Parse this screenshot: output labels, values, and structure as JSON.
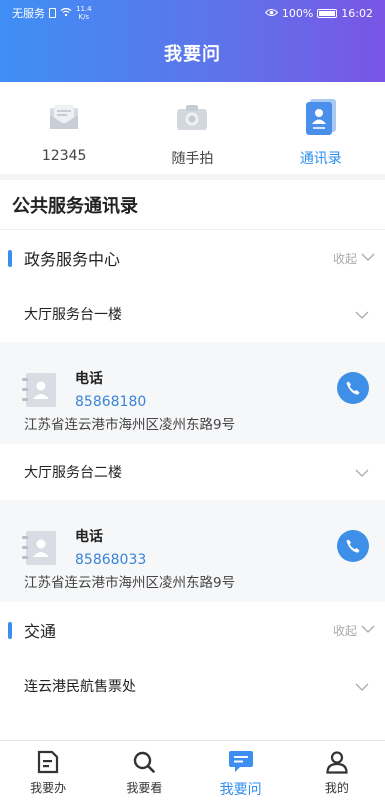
{
  "status": {
    "carrier": "无服务",
    "net_speed": "11.4",
    "net_unit": "K/s",
    "battery": "100%",
    "time": "16:02"
  },
  "header": {
    "title": "我要问"
  },
  "topnav": [
    {
      "label": "12345",
      "icon": "message-envelope-icon"
    },
    {
      "label": "随手拍",
      "icon": "camera-icon"
    },
    {
      "label": "通讯录",
      "icon": "contacts-book-icon",
      "active": true
    }
  ],
  "section_title": "公共服务通讯录",
  "groups": [
    {
      "title": "政务服务中心",
      "collapse_label": "收起",
      "rows": [
        {
          "title": "大厅服务台一楼",
          "contact": {
            "label": "电话",
            "phone": "85868180",
            "address": "江苏省连云港市海州区凌州东路9号"
          }
        },
        {
          "title": "大厅服务台二楼",
          "contact": {
            "label": "电话",
            "phone": "85868033",
            "address": "江苏省连云港市海州区凌州东路9号"
          }
        }
      ]
    },
    {
      "title": "交通",
      "collapse_label": "收起",
      "rows": [
        {
          "title": "连云港民航售票处"
        }
      ]
    }
  ],
  "bottomnav": [
    {
      "label": "我要办",
      "icon": "document-icon"
    },
    {
      "label": "我要看",
      "icon": "magnifier-icon"
    },
    {
      "label": "我要问",
      "icon": "chat-bubble-icon",
      "active": true
    },
    {
      "label": "我的",
      "icon": "user-icon"
    }
  ],
  "colors": {
    "accent": "#2e8ff0",
    "header_start": "#3f8ff5",
    "header_end": "#7a55e6"
  }
}
